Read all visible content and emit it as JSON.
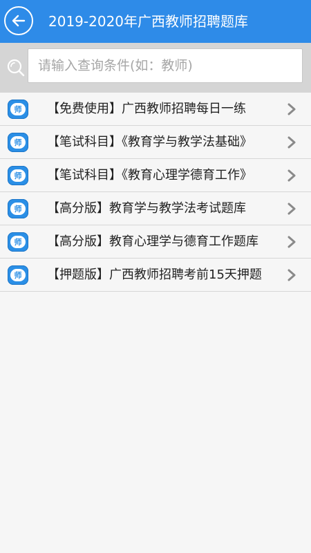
{
  "header": {
    "title": "2019-2020年广西教师招聘题库",
    "back_icon": "back-arrow-icon"
  },
  "search": {
    "placeholder": "请输入查询条件(如：教师)",
    "value": ""
  },
  "list": {
    "icon_text": "师",
    "items": [
      {
        "label": "【免费使用】广西教师招聘每日一练"
      },
      {
        "label": "【笔试科目】《教育学与教学法基础》"
      },
      {
        "label": "【笔试科目】《教育心理学德育工作》"
      },
      {
        "label": "【高分版】教育学与教学法考试题库"
      },
      {
        "label": "【高分版】教育心理学与德育工作题库"
      },
      {
        "label": "【押题版】广西教师招聘考前15天押题"
      }
    ]
  },
  "colors": {
    "accent": "#2e8be8",
    "background": "#f6f6f6",
    "search_bar": "#d5d5d5"
  }
}
